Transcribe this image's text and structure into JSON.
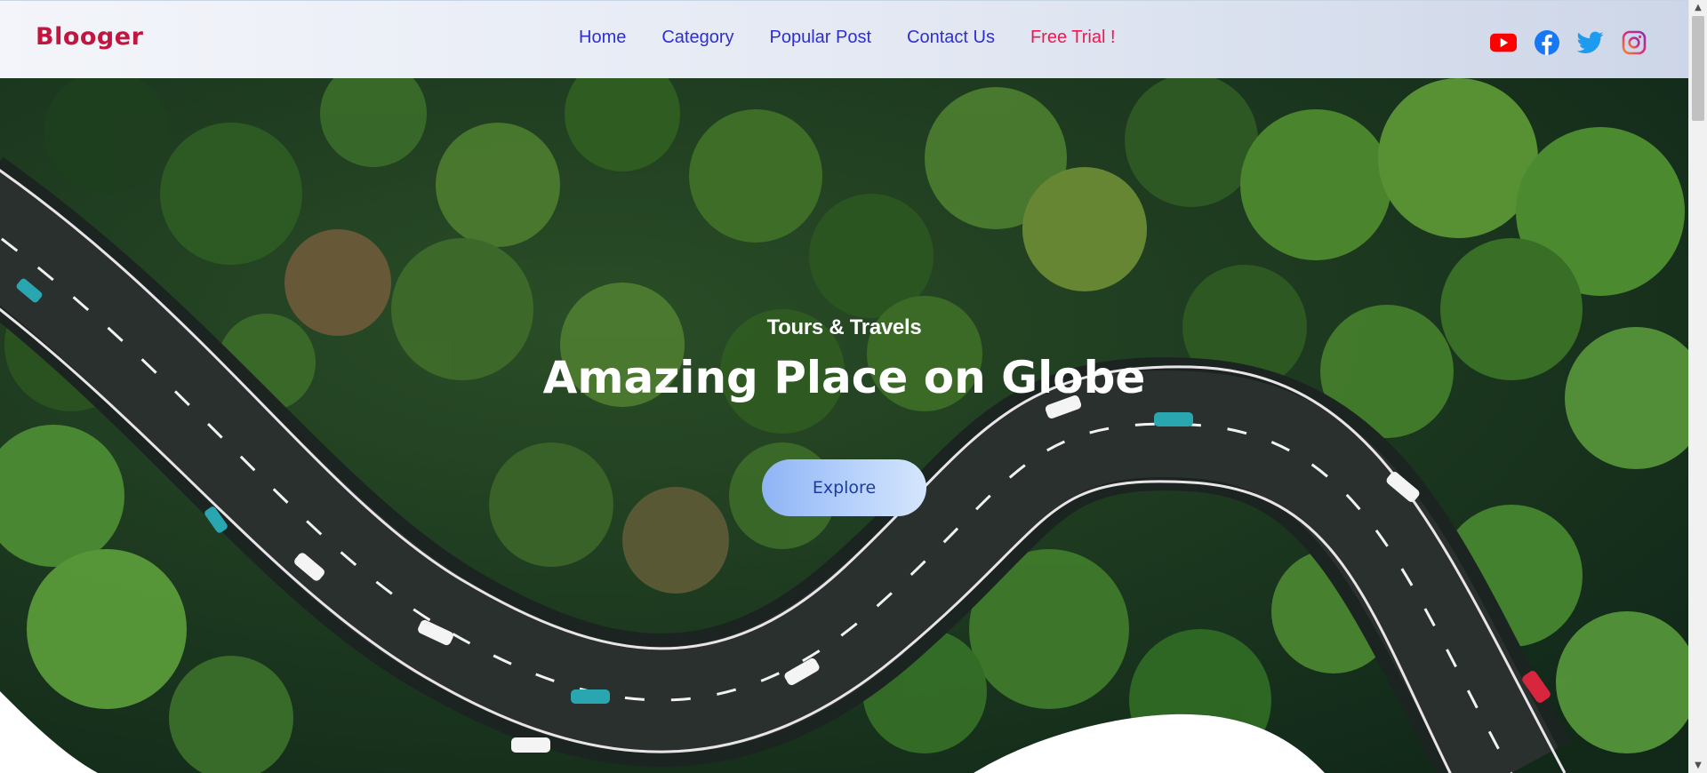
{
  "brand": {
    "name": "Blooger"
  },
  "nav": {
    "items": [
      {
        "label": "Home"
      },
      {
        "label": "Category"
      },
      {
        "label": "Popular Post"
      },
      {
        "label": "Contact Us"
      },
      {
        "label": "Free Trial !"
      }
    ]
  },
  "socials": [
    "youtube-icon",
    "facebook-icon",
    "twitter-icon",
    "instagram-icon"
  ],
  "hero": {
    "subtitle": "Tours & Travels",
    "title": "Amazing Place on Globe",
    "button_label": "Explore"
  },
  "colors": {
    "brand": "#c0163f",
    "nav_link": "#2f2fd0",
    "trial_link": "#f2164f",
    "youtube": "#ff0000",
    "facebook": "#1877f2",
    "twitter": "#1d9bf0",
    "instagram": "#e1306c"
  }
}
